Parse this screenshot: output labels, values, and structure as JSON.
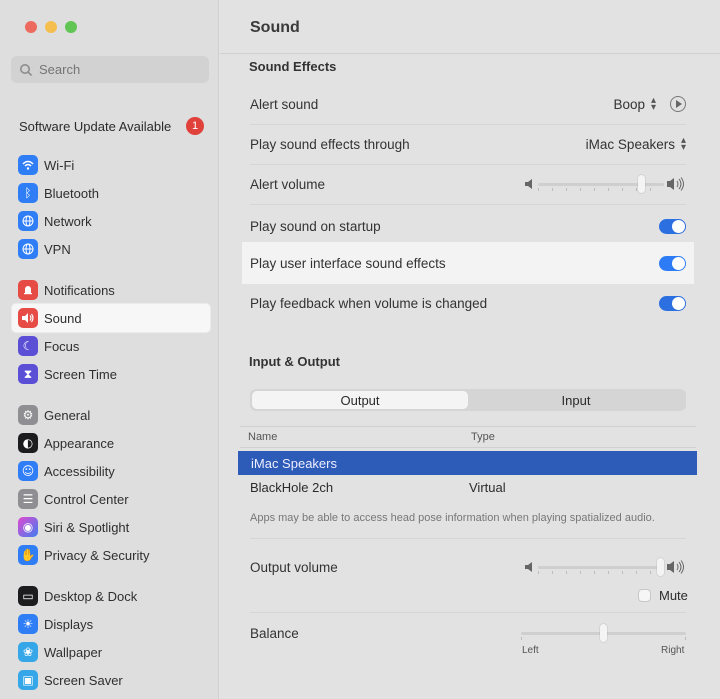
{
  "window": {
    "title": "Sound",
    "traffic_colors": [
      "#ec6a5e",
      "#f4bf4f",
      "#61c554"
    ]
  },
  "sidebar": {
    "search_placeholder": "Search",
    "update": {
      "label": "Software Update Available",
      "badge": "1"
    },
    "items": [
      {
        "label": "Wi-Fi",
        "icon": "wifi-icon",
        "color": "#2f7ef6"
      },
      {
        "label": "Bluetooth",
        "icon": "bluetooth-icon",
        "color": "#2f7ef6"
      },
      {
        "label": "Network",
        "icon": "globe-icon",
        "color": "#2f7ef6"
      },
      {
        "label": "VPN",
        "icon": "globe-icon",
        "color": "#2f7ef6"
      },
      {
        "label": "Notifications",
        "icon": "bell-icon",
        "color": "#e64b45"
      },
      {
        "label": "Sound",
        "icon": "speaker-icon",
        "color": "#e64b45"
      },
      {
        "label": "Focus",
        "icon": "moon-icon",
        "color": "#5b4fd6"
      },
      {
        "label": "Screen Time",
        "icon": "hourglass-icon",
        "color": "#5b4fd6"
      },
      {
        "label": "General",
        "icon": "gear-icon",
        "color": "#8e8e93"
      },
      {
        "label": "Appearance",
        "icon": "appearance-icon",
        "color": "#1c1c1e"
      },
      {
        "label": "Accessibility",
        "icon": "accessibility-icon",
        "color": "#2f7ef6"
      },
      {
        "label": "Control Center",
        "icon": "control-center-icon",
        "color": "#8e8e93"
      },
      {
        "label": "Siri & Spotlight",
        "icon": "siri-icon",
        "color": "#6a3fd1"
      },
      {
        "label": "Privacy & Security",
        "icon": "hand-icon",
        "color": "#2f7ef6"
      },
      {
        "label": "Desktop & Dock",
        "icon": "dock-icon",
        "color": "#1c1c1e"
      },
      {
        "label": "Displays",
        "icon": "display-icon",
        "color": "#2f7ef6"
      },
      {
        "label": "Wallpaper",
        "icon": "wallpaper-icon",
        "color": "#35a7e8"
      },
      {
        "label": "Screen Saver",
        "icon": "screensaver-icon",
        "color": "#35a7e8"
      }
    ]
  },
  "sound_effects": {
    "heading": "Sound Effects",
    "alert_sound": {
      "label": "Alert sound",
      "value": "Boop"
    },
    "play_through": {
      "label": "Play sound effects through",
      "value": "iMac Speakers"
    },
    "alert_volume": {
      "label": "Alert volume",
      "level": 0.82
    },
    "startup": {
      "label": "Play sound on startup",
      "on": true
    },
    "ui_effects": {
      "label": "Play user interface sound effects",
      "on": true
    },
    "feedback": {
      "label": "Play feedback when volume is changed",
      "on": true
    }
  },
  "input_output": {
    "heading": "Input & Output",
    "tabs": [
      "Output",
      "Input"
    ],
    "selected_tab": "Output",
    "columns": [
      "Name",
      "Type"
    ],
    "devices": [
      {
        "name": "iMac Speakers",
        "type": "",
        "selected": true
      },
      {
        "name": "BlackHole 2ch",
        "type": "Virtual",
        "selected": false
      }
    ],
    "note": "Apps may be able to access head pose information when playing spatialized audio."
  },
  "output": {
    "volume_label": "Output volume",
    "volume_level": 0.97,
    "mute_label": "Mute",
    "balance_label": "Balance",
    "balance_left": "Left",
    "balance_right": "Right",
    "balance_level": 0.5
  }
}
